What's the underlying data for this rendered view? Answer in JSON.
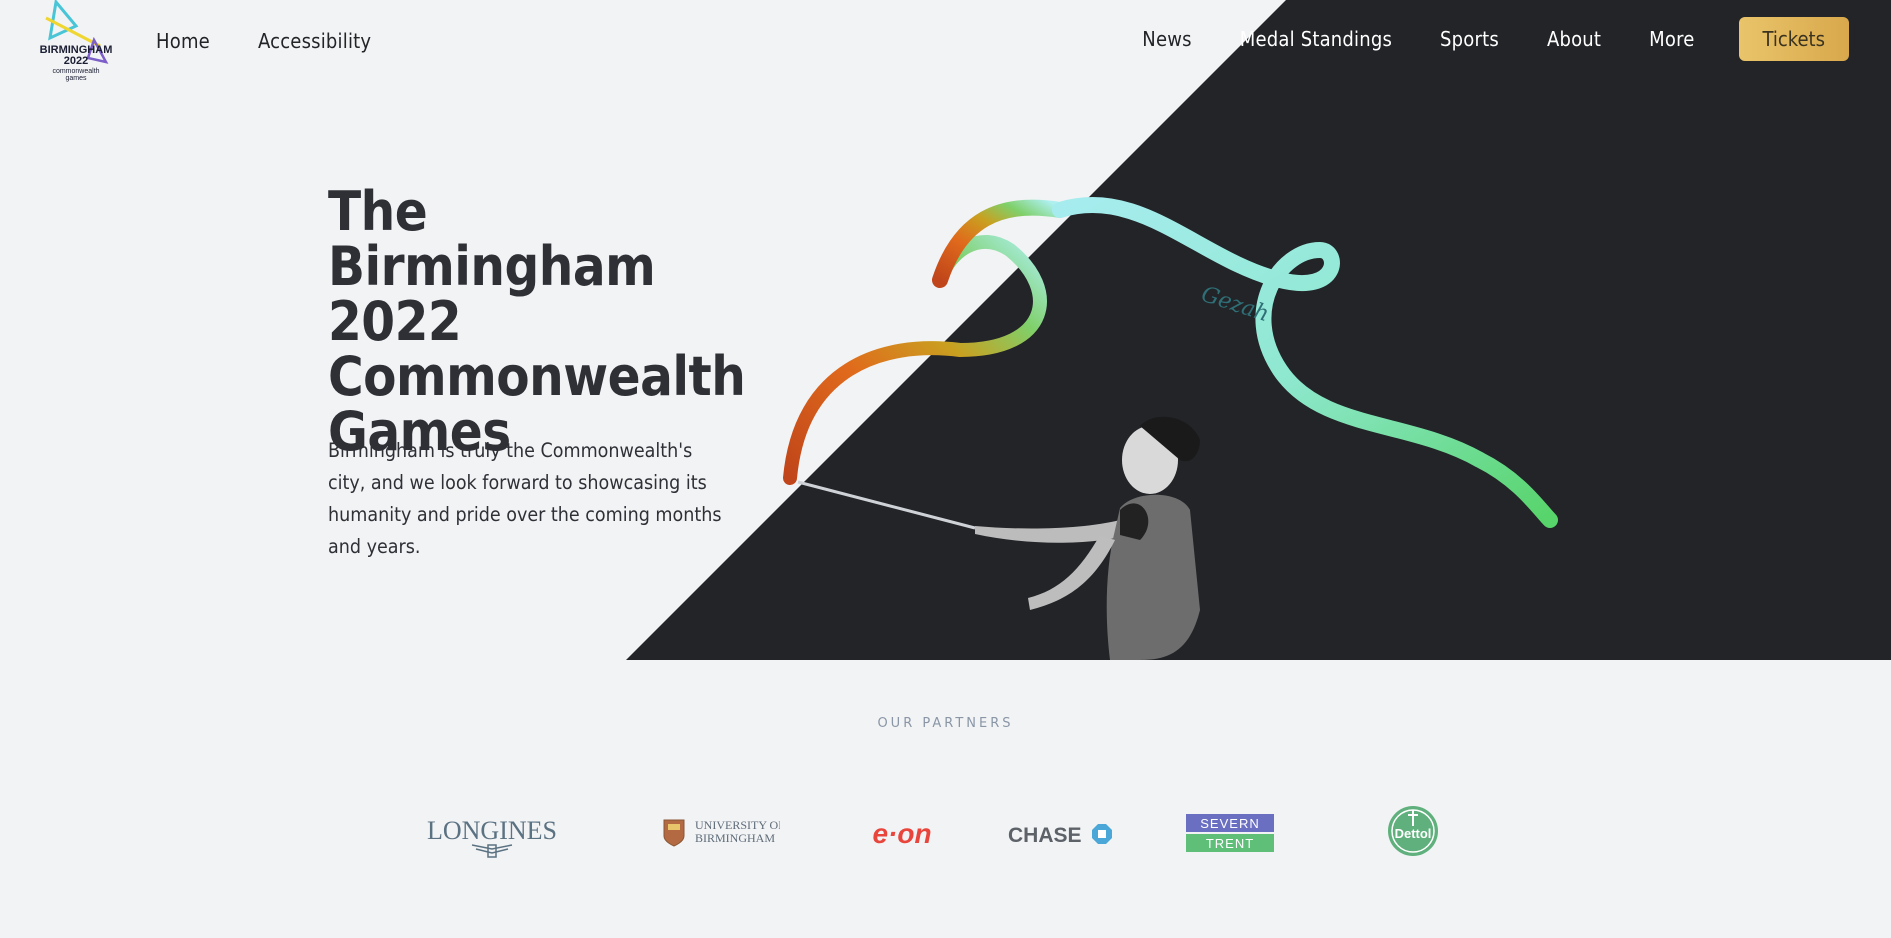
{
  "header": {
    "logo": {
      "line1": "BIRMINGHAM",
      "line2": "2022",
      "line3": "commonwealth",
      "line4": "games"
    },
    "nav_left": [
      {
        "label": "Home"
      },
      {
        "label": "Accessibility"
      }
    ],
    "nav_right": [
      {
        "label": "News"
      },
      {
        "label": "Medal Standings"
      },
      {
        "label": "Sports"
      },
      {
        "label": "About"
      },
      {
        "label": "More"
      }
    ],
    "tickets_label": "Tickets"
  },
  "hero": {
    "title_lines": [
      "The Birmingham",
      "2022",
      "Commonwealth",
      "Games"
    ],
    "description": "Birmingham is truly the Commonwealth's city, and we look forward to showcasing its humanity and pride over the coming months and years.",
    "ribbon_script": "Gezah"
  },
  "partners": {
    "heading": "OUR PARTNERS",
    "logos": {
      "longines": "LONGINES",
      "uob_line1": "UNIVERSITY OF",
      "uob_line2": "BIRMINGHAM",
      "eon": "e·on",
      "chase": "CHASE",
      "severn": "SEVERN",
      "trent": "TRENT",
      "dettol": "Dettol"
    }
  },
  "colors": {
    "background": "#f2f3f5",
    "hero_dark": "#222428",
    "tickets": "#e3b95e",
    "eon_red": "#e8453c",
    "partner_slate": "#5b7282"
  }
}
